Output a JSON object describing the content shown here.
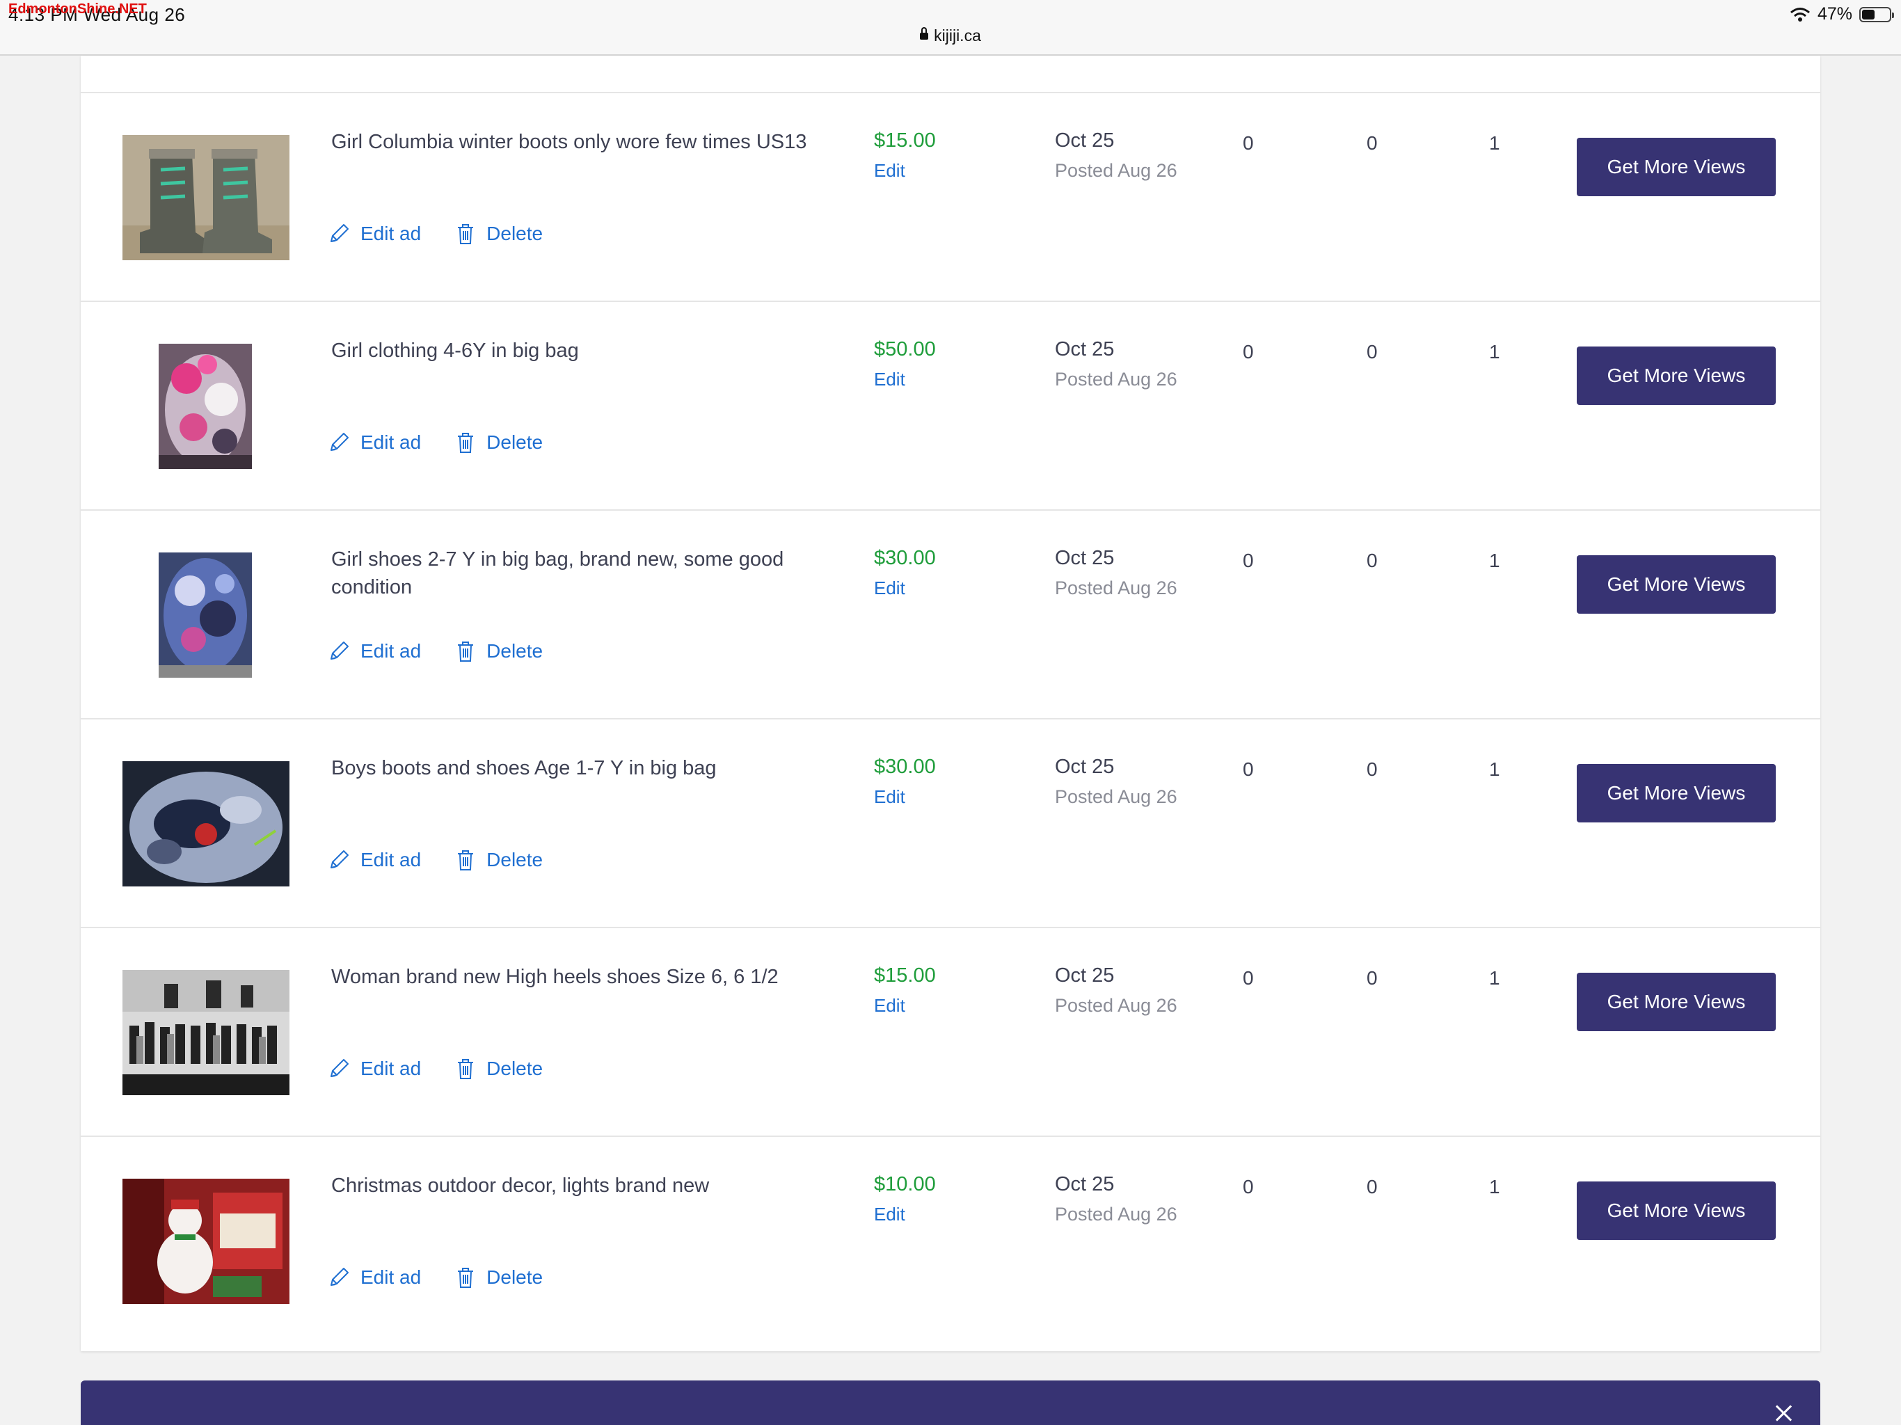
{
  "status_bar": {
    "watermark": "EdmontonShine.NET",
    "time": "4:13 PM  Wed Aug 26",
    "url": "kijiji.ca",
    "battery": "47%",
    "battery_level": 0.47
  },
  "ads": [
    {
      "title": "Girl Columbia winter boots only wore few times US13",
      "thumb_icon": "winter-boots-photo",
      "price": "$15.00",
      "price_edit": "Edit",
      "date": "Oct 25",
      "posted": "Posted Aug 26",
      "stat1": "0",
      "stat2": "0",
      "stat3": "1",
      "edit_label": "Edit ad",
      "delete_label": "Delete",
      "cta": "Get More Views"
    },
    {
      "title": "Girl clothing 4-6Y in big bag",
      "thumb_icon": "clothing-bag-photo",
      "price": "$50.00",
      "price_edit": "Edit",
      "date": "Oct 25",
      "posted": "Posted Aug 26",
      "stat1": "0",
      "stat2": "0",
      "stat3": "1",
      "edit_label": "Edit ad",
      "delete_label": "Delete",
      "cta": "Get More Views"
    },
    {
      "title": "Girl shoes 2-7 Y in big bag, brand new, some good condition",
      "thumb_icon": "shoes-bag-photo",
      "price": "$30.00",
      "price_edit": "Edit",
      "date": "Oct 25",
      "posted": "Posted Aug 26",
      "stat1": "0",
      "stat2": "0",
      "stat3": "1",
      "edit_label": "Edit ad",
      "delete_label": "Delete",
      "cta": "Get More Views"
    },
    {
      "title": "Boys boots and shoes Age 1-7 Y in big bag",
      "thumb_icon": "boys-shoes-bag-photo",
      "price": "$30.00",
      "price_edit": "Edit",
      "date": "Oct 25",
      "posted": "Posted Aug 26",
      "stat1": "0",
      "stat2": "0",
      "stat3": "1",
      "edit_label": "Edit ad",
      "delete_label": "Delete",
      "cta": "Get More Views"
    },
    {
      "title": "Woman brand new High heels shoes Size 6, 6 1/2",
      "thumb_icon": "high-heels-photo",
      "price": "$15.00",
      "price_edit": "Edit",
      "date": "Oct 25",
      "posted": "Posted Aug 26",
      "stat1": "0",
      "stat2": "0",
      "stat3": "1",
      "edit_label": "Edit ad",
      "delete_label": "Delete",
      "cta": "Get More Views"
    },
    {
      "title": "Christmas outdoor decor, lights brand new",
      "thumb_icon": "christmas-decor-photo",
      "price": "$10.00",
      "price_edit": "Edit",
      "date": "Oct 25",
      "posted": "Posted Aug 26",
      "stat1": "0",
      "stat2": "0",
      "stat3": "1",
      "edit_label": "Edit ad",
      "delete_label": "Delete",
      "cta": "Get More Views"
    }
  ],
  "colors": {
    "brand_purple": "#373373",
    "price_green": "#1f9d3b",
    "link_blue": "#1f6fd1"
  }
}
